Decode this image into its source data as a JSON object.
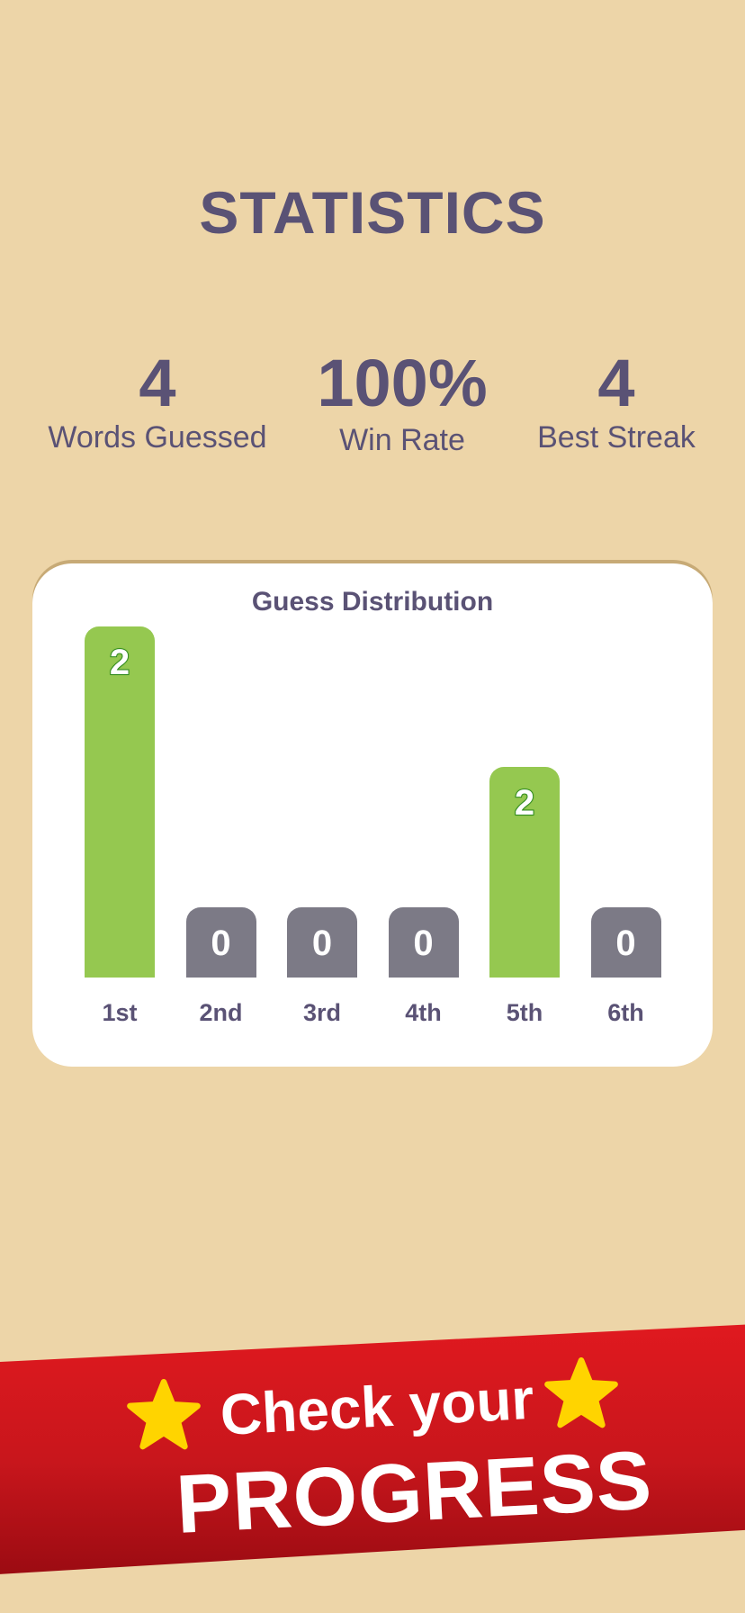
{
  "page": {
    "title": "STATISTICS"
  },
  "stats": [
    {
      "value": "4",
      "label": "Words Guessed"
    },
    {
      "value": "100%",
      "label": "Win Rate"
    },
    {
      "value": "4",
      "label": "Best Streak"
    }
  ],
  "distribution": {
    "title": "Guess Distribution"
  },
  "chart_data": {
    "type": "bar",
    "title": "Guess Distribution",
    "categories": [
      "1st",
      "2nd",
      "3rd",
      "4th",
      "5th",
      "6th"
    ],
    "values": [
      2,
      0,
      0,
      0,
      2,
      0
    ],
    "value_labels": [
      "2",
      "0",
      "0",
      "0",
      "2",
      "0"
    ],
    "colors": {
      "win": "#95c850",
      "zero": "#7c7a86"
    }
  },
  "banner": {
    "line1": "Check your",
    "line2": "PROGRESS",
    "icons": [
      "star-icon",
      "star-icon"
    ],
    "colors": {
      "ribbon": "#d61a1f",
      "star": "#ffd400"
    }
  },
  "colors": {
    "background": "#edd5a8",
    "text": "#5a5275",
    "card": "#ffffff"
  }
}
